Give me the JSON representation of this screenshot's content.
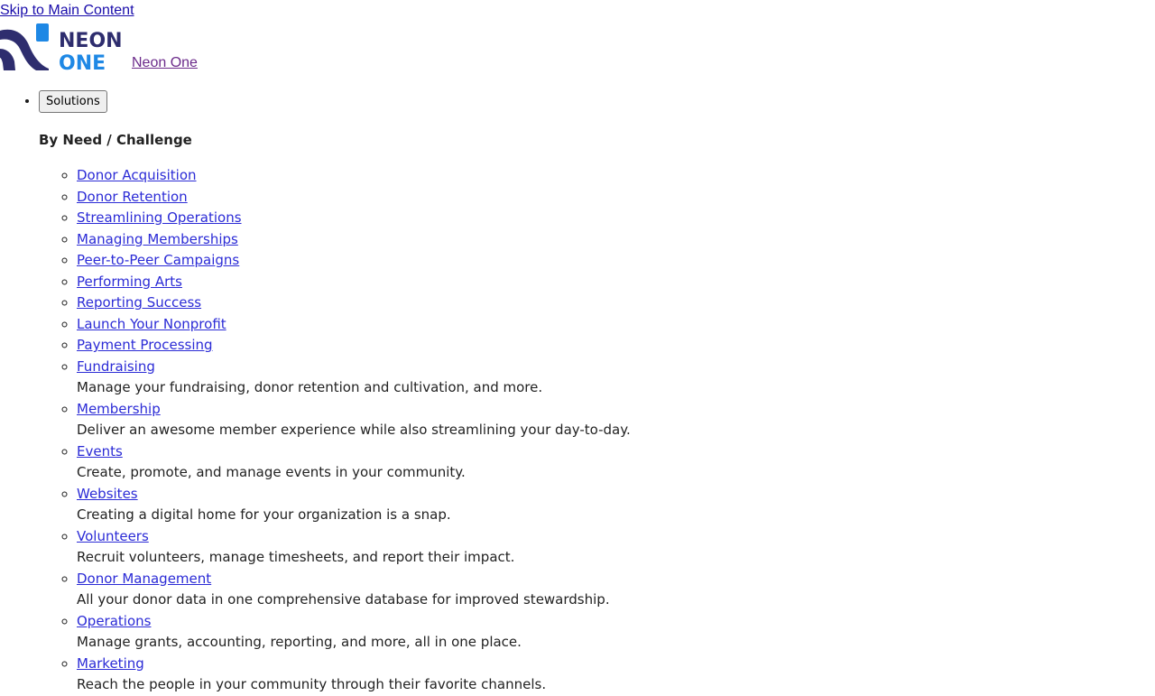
{
  "skip_link": "Skip to Main Content",
  "logo": {
    "word_top": "NEON",
    "word_bottom": "ONE",
    "link_text": " Neon One",
    "colors": {
      "navy": "#2e2d6e",
      "blue": "#1e88e5"
    }
  },
  "nav": {
    "solutions_button": "Solutions",
    "group_heading": "By Need / Challenge",
    "items": [
      {
        "label": "Donor Acquisition",
        "desc": ""
      },
      {
        "label": "Donor Retention",
        "desc": ""
      },
      {
        "label": "Streamlining Operations",
        "desc": ""
      },
      {
        "label": "Managing Memberships",
        "desc": ""
      },
      {
        "label": "Peer-to-Peer Campaigns",
        "desc": ""
      },
      {
        "label": "Performing Arts",
        "desc": ""
      },
      {
        "label": "Reporting Success",
        "desc": ""
      },
      {
        "label": "Launch Your Nonprofit",
        "desc": ""
      },
      {
        "label": "Payment Processing",
        "desc": ""
      },
      {
        "label": "Fundraising",
        "desc": "Manage your fundraising, donor retention and cultivation, and more."
      },
      {
        "label": "Membership",
        "desc": "Deliver an awesome member experience while also streamlining your day-to-day."
      },
      {
        "label": "Events",
        "desc": "Create, promote, and manage events in your community."
      },
      {
        "label": "Websites",
        "desc": "Creating a digital home for your organization is a snap."
      },
      {
        "label": "Volunteers",
        "desc": "Recruit volunteers, manage timesheets, and report their impact."
      },
      {
        "label": "Donor Management",
        "desc": "All your donor data in one comprehensive database for improved stewardship."
      },
      {
        "label": "Operations",
        "desc": "Manage grants, accounting, reporting, and more, all in one place."
      },
      {
        "label": "Marketing",
        "desc": "Reach the people in your community through their favorite channels."
      }
    ]
  }
}
